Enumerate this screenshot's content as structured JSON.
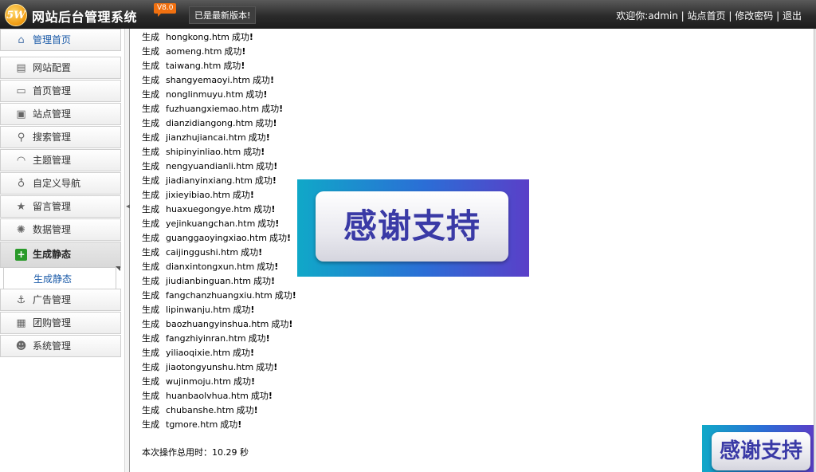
{
  "header": {
    "logo_text": "5W",
    "title": "网站后台管理系统",
    "version": "V8.0",
    "update_status": "已是最新版本!",
    "welcome": "欢迎你:admin",
    "sep": "|",
    "site_home": "站点首页",
    "change_password": "修改密码",
    "logout": "退出"
  },
  "sidebar": {
    "items": [
      {
        "label": "管理首页",
        "icon": "home-icon"
      },
      {
        "label": "网站配置",
        "icon": "book-icon"
      },
      {
        "label": "首页管理",
        "icon": "monitor-icon"
      },
      {
        "label": "站点管理",
        "icon": "tv-icon"
      },
      {
        "label": "搜索管理",
        "icon": "magnifier-icon"
      },
      {
        "label": "主题管理",
        "icon": "rainbow-icon"
      },
      {
        "label": "自定义导航",
        "icon": "lightbulb-icon"
      },
      {
        "label": "留言管理",
        "icon": "star-icon"
      },
      {
        "label": "数据管理",
        "icon": "gear-icon"
      },
      {
        "label": "生成静态",
        "icon": "plus-icon"
      },
      {
        "label": "广告管理",
        "icon": "anchor-icon"
      },
      {
        "label": "团购管理",
        "icon": "calendar-icon"
      },
      {
        "label": "系统管理",
        "icon": "user-icon"
      }
    ],
    "sub_item": "生成静态"
  },
  "log": {
    "prefix": "生成",
    "suffix": "成功",
    "mark": "!",
    "files": [
      "hongkong.htm",
      "aomeng.htm",
      "taiwang.htm",
      "shangyemaoyi.htm",
      "nonglinmuyu.htm",
      "fuzhuangxiemao.htm",
      "dianzidiangong.htm",
      "jianzhujiancai.htm",
      "shipinyinliao.htm",
      "nengyuandianli.htm",
      "jiadianyinxiang.htm",
      "jixieyibiao.htm",
      "huaxuegongye.htm",
      "yejinkuangchan.htm",
      "guanggaoyingxiao.htm",
      "caijinggushi.htm",
      "dianxintongxun.htm",
      "jiudianbinguan.htm",
      "fangchanzhuangxiu.htm",
      "lipinwanju.htm",
      "baozhuangyinshua.htm",
      "fangzhiyinran.htm",
      "yiliaoqixie.htm",
      "jiaotongyunshu.htm",
      "wujinmoju.htm",
      "huanbaolvhua.htm",
      "chubanshe.htm",
      "tgmore.htm"
    ],
    "elapsed": "本次操作总用时：10.29 秒"
  },
  "banner": {
    "text": "感谢支持"
  }
}
